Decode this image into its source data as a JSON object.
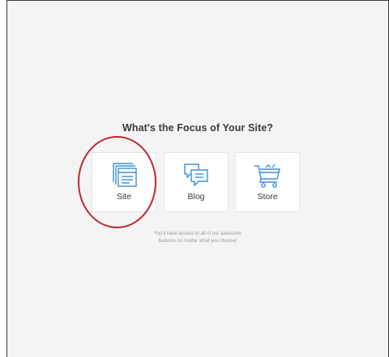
{
  "dialog": {
    "title": "What's the Focus of Your Site?",
    "options": [
      {
        "label": "Site",
        "icon": "site-pages-icon"
      },
      {
        "label": "Blog",
        "icon": "blog-chat-icon"
      },
      {
        "label": "Store",
        "icon": "shopping-cart-icon"
      }
    ],
    "note_line1": "You'll have access to all of our awesome",
    "note_line2": "features no matter what you choose!"
  },
  "colors": {
    "icon_blue": "#3b8fd9",
    "highlight_red": "#c0282d",
    "background": "#f4f4f4"
  }
}
